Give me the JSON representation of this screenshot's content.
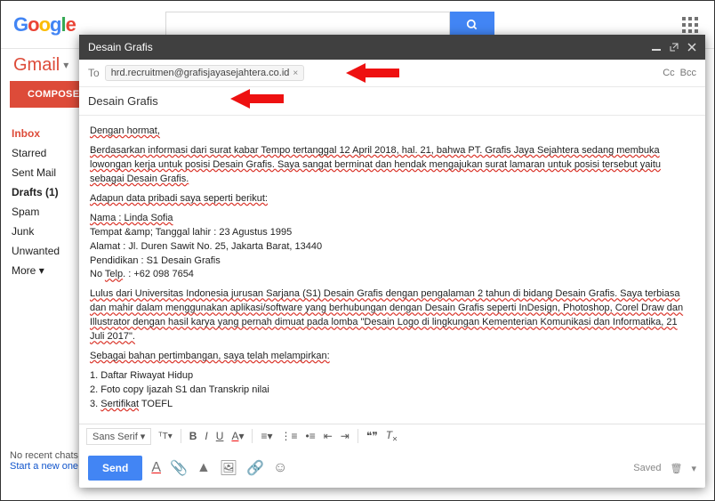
{
  "header": {
    "logo_letters": "Google",
    "search_placeholder": "",
    "search_value": ""
  },
  "gmail_label": "Gmail",
  "compose_label": "COMPOSE",
  "folders": {
    "inbox": "Inbox",
    "starred": "Starred",
    "sent": "Sent Mail",
    "drafts": "Drafts (1)",
    "spam": "Spam",
    "junk": "Junk",
    "unwanted": "Unwanted",
    "more": "More"
  },
  "quick": {
    "no_chats": "No recent chats",
    "start_new": "Start a new one"
  },
  "compose": {
    "title": "Desain Grafis",
    "to_label": "To",
    "recipient": "hrd.recruitmen@grafisjayasejahtera.co.id",
    "cc": "Cc",
    "bcc": "Bcc",
    "subject": "Desain Grafis",
    "body": {
      "greeting": "Dengan hormat,",
      "p1": "Berdasarkan informasi dari surat kabar Tempo tertanggal 12 April 2018, hal. 21, bahwa PT. Grafis Jaya Sejahtera sedang membuka lowongan kerja untuk posisi Desain Grafis. Saya sangat berminat dan hendak mengajukan surat lamaran untuk posisi tersebut yaitu sebagai Desain Grafis.",
      "p2": "Adapun data pribadi saya seperti berikut:",
      "nama": "Nama : Linda Sofia",
      "ttl": "Tempat &amp; Tanggal lahir : 23 Agustus 1995",
      "alamat": "Alamat : Jl. Duren Sawit No. 25, Jakarta Barat, 13440",
      "pendidikan": "Pendidikan : S1 Desain Grafis",
      "telp": "No Telp. : +62 098 7654",
      "p3": "Lulus dari Universitas Indonesia jurusan Sarjana (S1) Desain Grafis dengan pengalaman 2 tahun di bidang Desain Grafis. Saya terbiasa dan mahir dalam menggunakan aplikasi/software yang berhubungan dengan Desain Grafis seperti InDesign, Photoshop, Corel Draw dan Illustrator dengan hasil karya yang pernah dimuat pada lomba \"Desain Logo di lingkungan Kementerian Komunikasi dan Informatika, 21 Juli 2017\".",
      "p4": "Sebagai bahan pertimbangan, saya telah melampirkan:",
      "a1": "1. Daftar Riwayat Hidup",
      "a2": "2. Foto copy Ijazah S1 dan Transkrip nilai",
      "a3": "3. Sertifikat TOEFL"
    },
    "toolbar": {
      "font": "Sans Serif"
    },
    "send_label": "Send",
    "saved_label": "Saved"
  }
}
